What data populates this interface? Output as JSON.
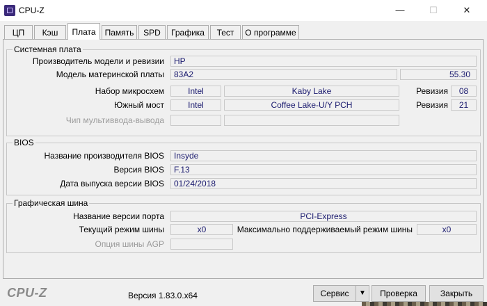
{
  "window": {
    "title": "CPU-Z",
    "minimize": "—",
    "maximize": "☐",
    "close": "✕"
  },
  "tabs": [
    {
      "label": "ЦП"
    },
    {
      "label": "Кэш"
    },
    {
      "label": "Плата"
    },
    {
      "label": "Память"
    },
    {
      "label": "SPD"
    },
    {
      "label": "Графика"
    },
    {
      "label": "Тест"
    },
    {
      "label": "О программе"
    }
  ],
  "active_tab": "Плата",
  "motherboard": {
    "group_title": "Системная плата",
    "manufacturer_label": "Производитель модели и ревизии",
    "manufacturer_value": "HP",
    "model_label": "Модель материнской платы",
    "model_value": "83A2",
    "model_extra": "55.30",
    "chipset_label": "Набор микросхем",
    "chipset_vendor": "Intel",
    "chipset_name": "Kaby Lake",
    "chipset_rev_label": "Ревизия",
    "chipset_rev": "08",
    "southbridge_label": "Южный мост",
    "southbridge_vendor": "Intel",
    "southbridge_name": "Coffee Lake-U/Y PCH",
    "southbridge_rev_label": "Ревизия",
    "southbridge_rev": "21",
    "lpcio_label": "Чип мультиввода-вывода"
  },
  "bios": {
    "group_title": "BIOS",
    "brand_label": "Название производителя BIOS",
    "brand_value": "Insyde",
    "version_label": "Версия BIOS",
    "version_value": "F.13",
    "date_label": "Дата выпуска версии BIOS",
    "date_value": "01/24/2018"
  },
  "graphics": {
    "group_title": "Графическая шина",
    "version_label": "Название версии порта",
    "version_value": "PCI-Express",
    "link_label": "Текущий режим шины",
    "link_value": "x0",
    "max_label": "Максимально поддерживаемый режим шины",
    "max_value": "x0",
    "agp_label": "Опция шины AGP"
  },
  "footer": {
    "logo": "CPU-Z",
    "version": "Версия 1.83.0.x64",
    "tools_label": "Сервис",
    "tools_arrow": "▼",
    "validate_label": "Проверка",
    "close_label": "Закрыть"
  },
  "colors": {
    "value_text": "#1a1a6e",
    "panel_bg": "#f0f0f0"
  },
  "icons": {
    "app": "cpu-z-app-icon"
  }
}
